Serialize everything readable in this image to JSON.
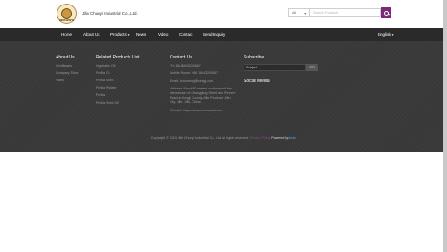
{
  "header": {
    "company_name": "Jilin Chunyi Industrial Co., Ltd.",
    "logo_text": "JINCHUNYI",
    "search_select": "All",
    "search_placeholder": "Search Products",
    "search_icon": "search-icon"
  },
  "nav": {
    "items": [
      {
        "label": "Home"
      },
      {
        "label": "About Us"
      },
      {
        "label": "Products"
      },
      {
        "label": "News"
      },
      {
        "label": "Video"
      },
      {
        "label": "Contact"
      },
      {
        "label": "Send Inquiry"
      }
    ],
    "products_caret": "▾",
    "language": "English",
    "language_caret": "▾"
  },
  "footer": {
    "about": {
      "title": "About Us",
      "links": [
        "Certificates",
        "Company Show",
        "Video"
      ]
    },
    "related": {
      "title": "Related Products List",
      "links": [
        "Vegetable Oil",
        "Perilla Oil",
        "Perilla Seed",
        "Perilla Protein",
        "Perilla",
        "Perilla Seed Oil"
      ]
    },
    "contact": {
      "title": "Contact Us",
      "tel": "Tel: 86-18943250667",
      "mobile": "Mobile Phone: +86 18943250667",
      "email": "Email: bsnonedq@tonngj.com",
      "address_lines": [
        "Address: About 80 meters southeast of the",
        "intersection of Changjiang Street and Renmin",
        "Road in Yongji County, Jilin Province, Jilin",
        "City, Jilin, Jilin, China"
      ],
      "website": "Website: https://www.zunhuasui.com"
    },
    "subscribe": {
      "title": "Subscribe",
      "input_value": "Subject",
      "button_label": "GO",
      "social_title": "Social Media"
    },
    "copyright": {
      "text": "Copyright © 2024 Jilin Chunyi Industrial Co., Ltd All rights reserved.",
      "policy": "Privacy Policy",
      "powered": "Powered by",
      "brand": "dedu"
    }
  },
  "colors": {
    "nav_bg": "#2a2a2a",
    "footer_bg": "#383838",
    "accent": "#7b2a7b"
  }
}
